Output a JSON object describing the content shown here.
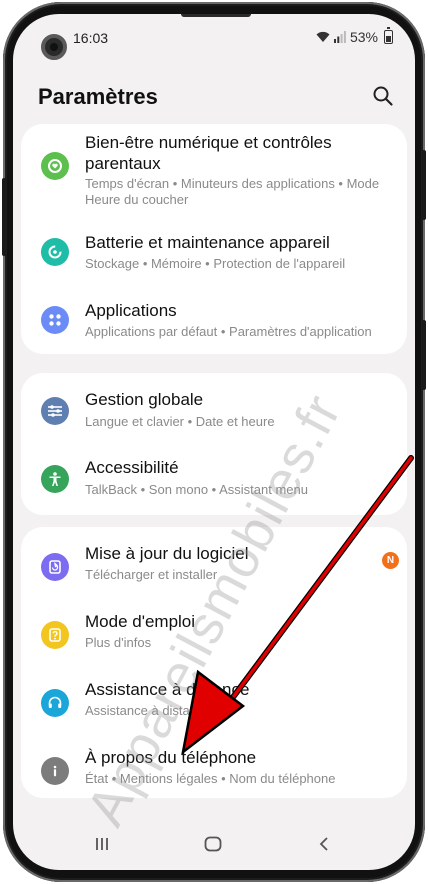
{
  "status_bar": {
    "time": "16:03",
    "battery": "53%"
  },
  "header": {
    "title": "Paramètres",
    "search_icon": "search-icon"
  },
  "groups": [
    {
      "items": [
        {
          "title": "Bien-être numérique et contrôles parentaux",
          "subtitle": "Temps d'écran  •  Minuteurs des applications  •  Mode Heure du coucher",
          "icon": "digital-wellbeing-icon",
          "icon_color": "#5dc04e"
        },
        {
          "title": "Batterie et maintenance appareil",
          "subtitle": "Stockage  •  Mémoire  •  Protection de l'appareil",
          "icon": "battery-care-icon",
          "icon_color": "#1fbca8"
        },
        {
          "title": "Applications",
          "subtitle": "Applications par défaut  •  Paramètres d'application",
          "icon": "apps-icon",
          "icon_color": "#6b8cf6"
        }
      ]
    },
    {
      "items": [
        {
          "title": "Gestion globale",
          "subtitle": "Langue et clavier  •  Date et heure",
          "icon": "sliders-icon",
          "icon_color": "#5f7fb0"
        },
        {
          "title": "Accessibilité",
          "subtitle": "TalkBack  •  Son mono  •  Assistant menu",
          "icon": "accessibility-icon",
          "icon_color": "#36a45a"
        }
      ]
    },
    {
      "items": [
        {
          "title": "Mise à jour du logiciel",
          "subtitle": "Télécharger et installer",
          "icon": "software-update-icon",
          "icon_color": "#7b6cf2",
          "badge": "N"
        },
        {
          "title": "Mode d'emploi",
          "subtitle": "Plus d'infos",
          "icon": "user-manual-icon",
          "icon_color": "#f2c51f"
        },
        {
          "title": "Assistance à distance",
          "subtitle": "Assistance à distance",
          "icon": "headset-icon",
          "icon_color": "#1aa6d8"
        },
        {
          "title": "À propos du téléphone",
          "subtitle": "État  •  Mentions légales  •  Nom du téléphone",
          "icon": "info-icon",
          "icon_color": "#7c7c7c"
        }
      ]
    }
  ],
  "nav_bar": {
    "recents_icon": "recents-icon",
    "home_icon": "home-icon",
    "back_icon": "back-icon"
  },
  "watermark": "Appareilsmobiles.fr",
  "colors": {
    "screen_bg": "#f3f1f2",
    "card_bg": "#ffffff",
    "arrow": "#e00000",
    "badge": "#f3701b"
  }
}
